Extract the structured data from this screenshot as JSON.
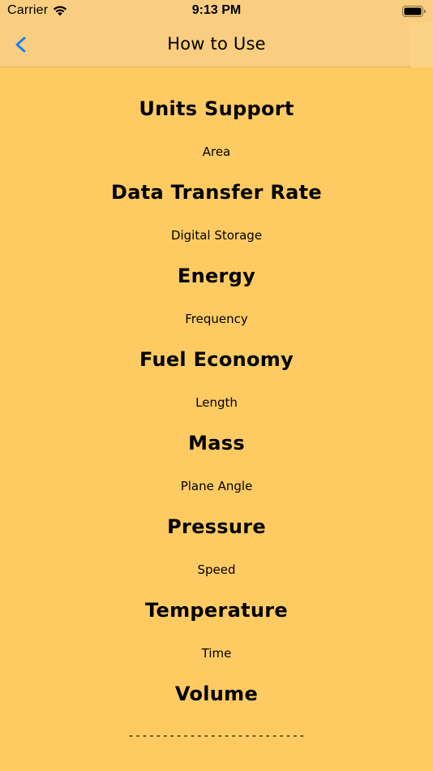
{
  "status_bar": {
    "carrier": "Carrier",
    "time": "9:13 PM",
    "wifi_icon": "wifi-icon",
    "battery_icon": "battery-icon"
  },
  "nav": {
    "title": "How to Use",
    "back_icon": "chevron-left-icon",
    "accent_color": "#1E7CF2",
    "bar_color": "#F9CE80"
  },
  "content": {
    "background_color": "#FECB62",
    "items": [
      {
        "type": "heading",
        "text": "Units Support"
      },
      {
        "type": "sub",
        "text": "Area"
      },
      {
        "type": "heading",
        "text": "Data Transfer Rate"
      },
      {
        "type": "sub",
        "text": "Digital Storage"
      },
      {
        "type": "heading",
        "text": "Energy"
      },
      {
        "type": "sub",
        "text": "Frequency"
      },
      {
        "type": "heading",
        "text": "Fuel Economy"
      },
      {
        "type": "sub",
        "text": "Length"
      },
      {
        "type": "heading",
        "text": "Mass"
      },
      {
        "type": "sub",
        "text": "Plane Angle"
      },
      {
        "type": "heading",
        "text": "Pressure"
      },
      {
        "type": "sub",
        "text": "Speed"
      },
      {
        "type": "heading",
        "text": "Temperature"
      },
      {
        "type": "sub",
        "text": "Time"
      },
      {
        "type": "heading",
        "text": "Volume"
      },
      {
        "type": "divider",
        "text": "--------------------------"
      }
    ]
  }
}
